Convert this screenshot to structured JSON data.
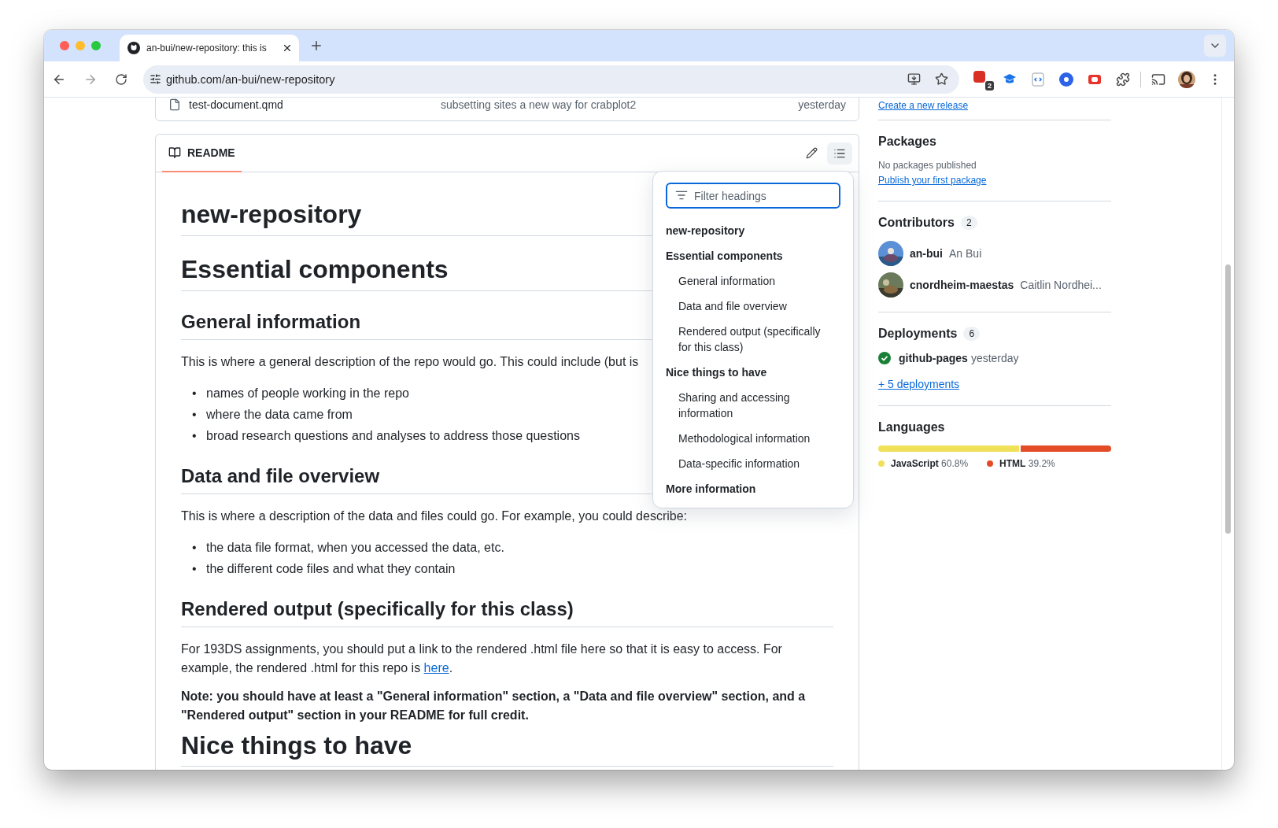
{
  "browser": {
    "tab_title": "an-bui/new-repository: this is",
    "url": "github.com/an-bui/new-repository",
    "extension_badge": "2"
  },
  "files": [
    {
      "name": "test-document.qmd",
      "message": "subsetting sites a new way for crabplot2",
      "time": "yesterday"
    }
  ],
  "readme": {
    "tab_label": "README",
    "blocks": [
      {
        "kind": "h1",
        "text": "new-repository"
      },
      {
        "kind": "h1",
        "text": "Essential components"
      },
      {
        "kind": "h2",
        "text": "General information"
      },
      {
        "kind": "p",
        "text": "This is where a general description of the repo would go. This could include (but is"
      },
      {
        "kind": "ul",
        "marker": "•",
        "items": [
          "names of people working in the repo",
          "where the data came from",
          "broad research questions and analyses to address those questions"
        ]
      },
      {
        "kind": "h2",
        "text": "Data and file overview"
      },
      {
        "kind": "p",
        "text": "This is where a description of the data and files could go. For example, you could describe:"
      },
      {
        "kind": "ul",
        "marker": "•",
        "items": [
          "the data file format, when you accessed the data, etc.",
          "the different code files and what they contain"
        ]
      },
      {
        "kind": "h2",
        "text": "Rendered output (specifically for this class)"
      },
      {
        "kind": "p",
        "text": "For 193DS assignments, you should put a link to the rendered .html file here so that it is easy to access. For example, the rendered .html for this repo is ",
        "link": "here",
        "after": "."
      },
      {
        "kind": "note",
        "text": "Note: you should have at least a \"General information\" section, a \"Data and file overview\" section, and a \"Rendered output\" section in your README for full credit."
      },
      {
        "kind": "h1",
        "text": "Nice things to have"
      }
    ],
    "toc": {
      "placeholder": "Filter headings",
      "items": [
        {
          "label": "new-repository"
        },
        {
          "label": "Essential components",
          "children": [
            {
              "label": "General information"
            },
            {
              "label": "Data and file overview"
            },
            {
              "label": "Rendered output (specifically for this class)"
            }
          ]
        },
        {
          "label": "Nice things to have",
          "children": [
            {
              "label": "Sharing and accessing information"
            },
            {
              "label": "Methodological information"
            },
            {
              "label": "Data-specific information"
            }
          ]
        },
        {
          "label": "More information"
        }
      ]
    }
  },
  "sidebar": {
    "release_link": "Create a new release",
    "packages": {
      "title": "Packages",
      "text": "No packages published",
      "link": "Publish your first package"
    },
    "contributors": {
      "title": "Contributors",
      "count": "2",
      "people": [
        {
          "login": "an-bui",
          "name": "An Bui"
        },
        {
          "login": "cnordheim-maestas",
          "name": "Caitlin Nordhei..."
        }
      ]
    },
    "deployments": {
      "title": "Deployments",
      "count": "6",
      "items": [
        {
          "name": "github-pages",
          "time": "yesterday",
          "succeeded": true
        }
      ],
      "more_link": "+ 5 deployments"
    },
    "languages": {
      "title": "Languages",
      "items": [
        {
          "name": "JavaScript",
          "percent": "60.8%",
          "color": "#f1e05a",
          "level": 0.608
        },
        {
          "name": "HTML",
          "percent": "39.2%",
          "color": "#e34c26",
          "level": 0.392
        }
      ]
    }
  }
}
